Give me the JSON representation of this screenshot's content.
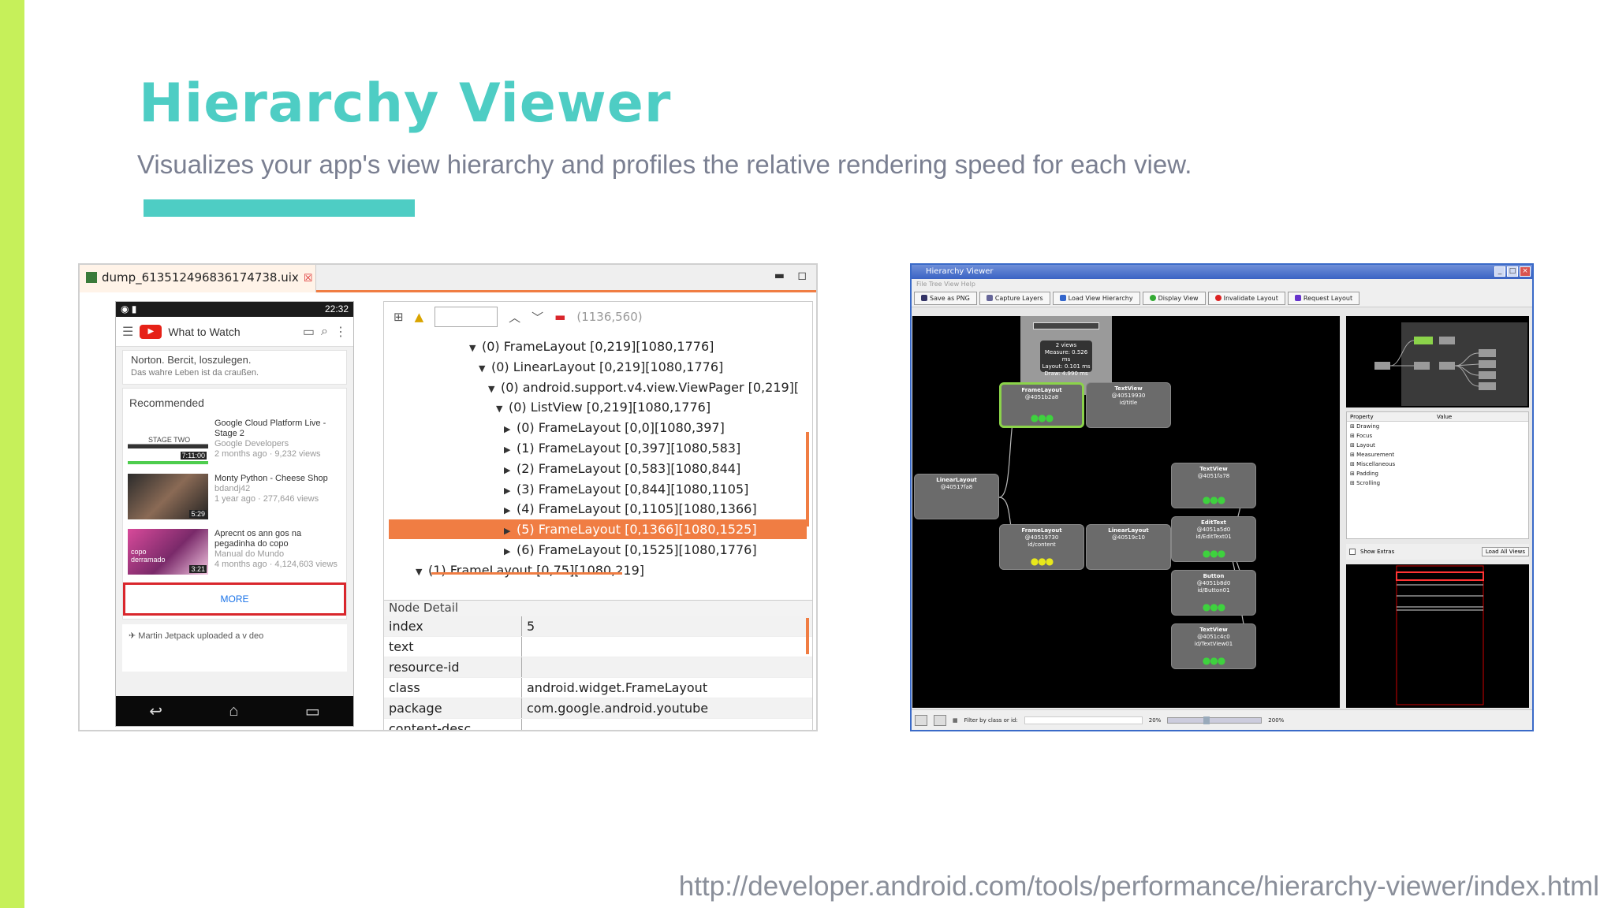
{
  "slide": {
    "title": "Hierarchy Viewer",
    "subtitle": "Visualizes your app's view hierarchy and profiles the relative rendering speed for each view.",
    "footer_url": "http://developer.android.com/tools/performance/hierarchy-viewer/index.html",
    "colors": {
      "accent": "#4ecdc4",
      "left_bar": "#c6f05a",
      "selection": "#f07d43"
    }
  },
  "dump": {
    "tab_title": "dump_613512496836174738.uix",
    "phone": {
      "time": "22:32",
      "app_title": "What to Watch",
      "note_line1": "Norton. Bercit, loszulegen.",
      "note_line2": "Das wahre Leben ist da craußen.",
      "section": "Recommended",
      "videos": [
        {
          "title": "Google Cloud Platform Live - Stage 2",
          "channel": "Google Developers",
          "meta": "2 months ago · 9,232 views",
          "duration": "7:11:00",
          "thumb_label": "STAGE TWO"
        },
        {
          "title": "Monty Python - Cheese Shop",
          "channel": "bdandj42",
          "meta": "1 year ago · 277,646 views",
          "duration": "5:29",
          "thumb_label": ""
        },
        {
          "title": "Aprecnt os ann gos na pegadinha do copo",
          "channel": "Manual do Mundo",
          "meta": "4 months ago · 4,124,603 views",
          "duration": "3:21",
          "thumb_label": "copo derramado"
        }
      ],
      "more_label": "MORE",
      "upload_text": "Martin Jetpack uploaded a v deo"
    },
    "toolbar": {
      "coords": "(1136,560)"
    },
    "tree": [
      {
        "label": "(0) FrameLayout [0,219][1080,1776]",
        "depth": 0,
        "arrow": "▼",
        "selected": false
      },
      {
        "label": "(0) LinearLayout [0,219][1080,1776]",
        "depth": 1,
        "arrow": "▼",
        "selected": false
      },
      {
        "label": "(0) android.support.v4.view.ViewPager [0,219][",
        "depth": 2,
        "arrow": "▼",
        "selected": false
      },
      {
        "label": "(0) ListView [0,219][1080,1776]",
        "depth": 3,
        "arrow": "▼",
        "selected": false
      },
      {
        "label": "(0) FrameLayout [0,0][1080,397]",
        "depth": 4,
        "arrow": "▶",
        "selected": false
      },
      {
        "label": "(1) FrameLayout [0,397][1080,583]",
        "depth": 4,
        "arrow": "▶",
        "selected": false
      },
      {
        "label": "(2) FrameLayout [0,583][1080,844]",
        "depth": 4,
        "arrow": "▶",
        "selected": false
      },
      {
        "label": "(3) FrameLayout [0,844][1080,1105]",
        "depth": 4,
        "arrow": "▶",
        "selected": false
      },
      {
        "label": "(4) FrameLayout [0,1105][1080,1366]",
        "depth": 4,
        "arrow": "▶",
        "selected": false
      },
      {
        "label": "(5) FrameLayout [0,1366][1080,1525]",
        "depth": 4,
        "arrow": "▶",
        "selected": true
      },
      {
        "label": "(6) FrameLayout [0,1525][1080,1776]",
        "depth": 4,
        "arrow": "▶",
        "selected": false
      },
      {
        "label": "(1) FrameLayout [0,75][1080,219]",
        "depth": -1,
        "arrow": "▼",
        "selected": false
      }
    ],
    "node_detail": {
      "heading": "Node Detail",
      "rows": [
        {
          "key": "index",
          "value": "5"
        },
        {
          "key": "text",
          "value": ""
        },
        {
          "key": "resource-id",
          "value": ""
        },
        {
          "key": "class",
          "value": "android.widget.FrameLayout"
        },
        {
          "key": "package",
          "value": "com.google.android.youtube"
        },
        {
          "key": "content-desc",
          "value": ""
        }
      ]
    }
  },
  "hv": {
    "window_title": "Hierarchy Viewer",
    "menu": "File   Tree View   Help",
    "buttons": [
      "Save as PNG",
      "Capture Layers",
      "Load View Hierarchy",
      "Display View",
      "Invalidate Layout",
      "Request Layout"
    ],
    "tooltip": {
      "line1": "2 views",
      "line2": "Measure: 0.526 ms",
      "line3": "Layout: 0.101 ms",
      "line4": "Draw: 4.990 ms"
    },
    "nodes": [
      {
        "name": "LinearLayout",
        "id": "@40517fa8",
        "sub": "",
        "dots": "",
        "dotcolor": "#fff",
        "selected": false
      },
      {
        "name": "FrameLayout",
        "id": "@4051b2a8",
        "sub": "",
        "dots": "●●●",
        "dotcolor": "#3ed23e",
        "selected": true
      },
      {
        "name": "TextView",
        "id": "@40519930",
        "sub": "id/title",
        "dots": "",
        "dotcolor": "#fff",
        "selected": false
      },
      {
        "name": "FrameLayout",
        "id": "@40519730",
        "sub": "id/content",
        "dots": "●●●",
        "dotcolor": "#e8e81c",
        "selected": false
      },
      {
        "name": "LinearLayout",
        "id": "@40519c10",
        "sub": "",
        "dots": "",
        "dotcolor": "#fff",
        "selected": false
      },
      {
        "name": "TextView",
        "id": "@4051fa78",
        "sub": "",
        "dots": "●●●",
        "dotcolor": "#3ed23e",
        "selected": false
      },
      {
        "name": "EditText",
        "id": "@4051a5d0",
        "sub": "id/EditText01",
        "dots": "●●●",
        "dotcolor": "#3ed23e",
        "selected": false
      },
      {
        "name": "Button",
        "id": "@4051b8d0",
        "sub": "id/Button01",
        "dots": "●●●",
        "dotcolor": "#3ed23e",
        "selected": false
      },
      {
        "name": "TextView",
        "id": "@4051c4c0",
        "sub": "id/TextView01",
        "dots": "●●●",
        "dotcolor": "#3ed23e",
        "selected": false
      }
    ],
    "props": {
      "col_property": "Property",
      "col_value": "Value",
      "items": [
        "Drawing",
        "Focus",
        "Layout",
        "Measurement",
        "Miscellaneous",
        "Padding",
        "Scrolling"
      ]
    },
    "show_extras": "Show Extras",
    "load_all_views": "Load All Views",
    "filter_label": "Filter by class or id:",
    "zoom_min": "20%",
    "zoom_max": "200%"
  }
}
